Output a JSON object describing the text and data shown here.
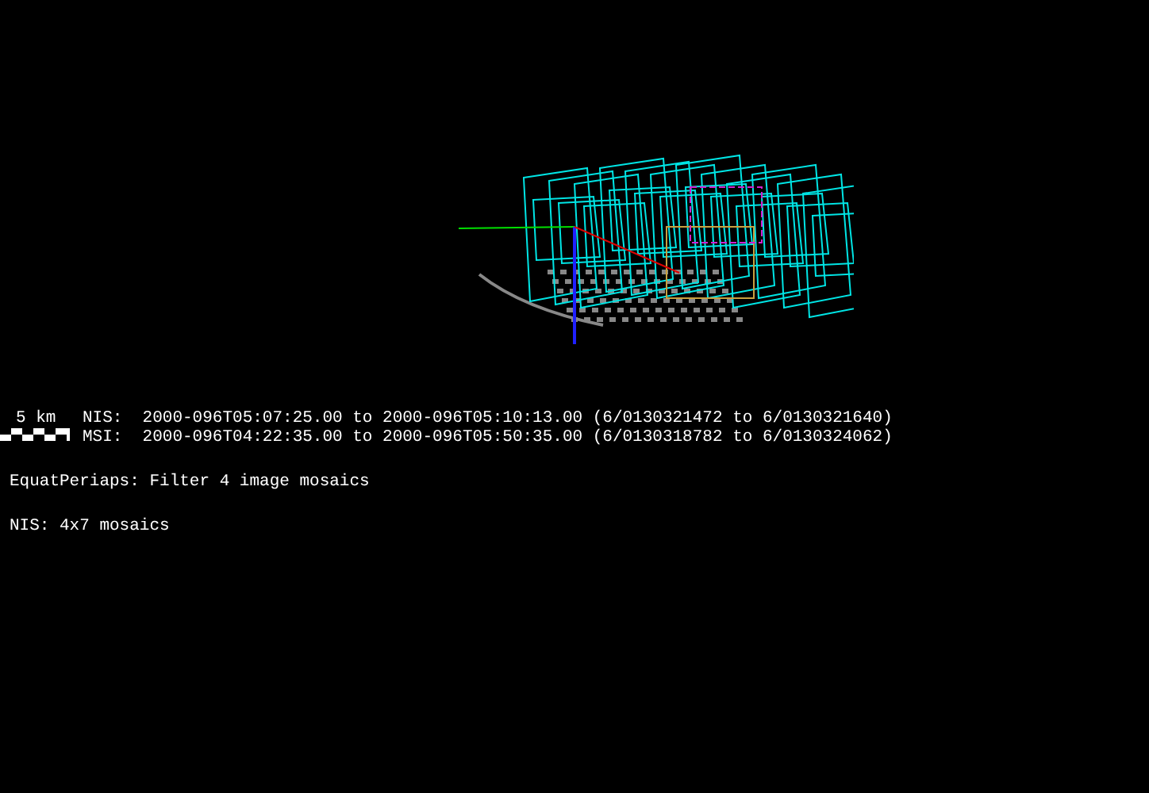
{
  "scale_bar": {
    "label": "5 km"
  },
  "time_ranges": [
    {
      "text": "NIS:  2000-096T05:07:25.00 to 2000-096T05:10:13.00 (6/0130321472 to 6/0130321640)"
    },
    {
      "text": "MSI:  2000-096T04:22:35.00 to 2000-096T05:50:35.00 (6/0130318782 to 6/0130324062)"
    }
  ],
  "title": "EquatPeriaps: Filter 4 image mosaics",
  "note": "NIS: 4x7 mosaics"
}
